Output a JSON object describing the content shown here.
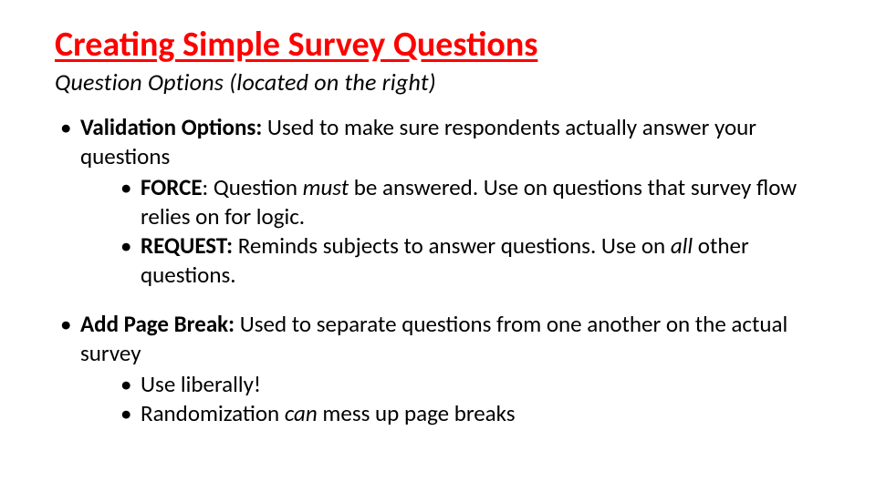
{
  "title": "Creating Simple Survey Questions",
  "subtitle": "Question Options (located on the right)",
  "bullets": [
    {
      "lead": "Validation Options:",
      "rest": " Used to make sure respondents actually answer your questions",
      "sub": [
        {
          "lead": "FORCE",
          "colon": ": Question ",
          "em": "must",
          "rest": " be answered. Use on questions that survey flow relies on for logic."
        },
        {
          "lead": "REQUEST:",
          "colon": " Reminds subjects to answer questions. Use on ",
          "em": "all",
          "rest": " other questions."
        }
      ]
    },
    {
      "lead": "Add Page Break:",
      "rest": " Used to separate questions from one another on the actual survey",
      "sub": [
        {
          "lead": "",
          "colon": "Use liberally!",
          "em": "",
          "rest": ""
        },
        {
          "lead": "",
          "colon": "Randomization ",
          "em": "can",
          "rest": " mess up page breaks"
        }
      ]
    }
  ]
}
